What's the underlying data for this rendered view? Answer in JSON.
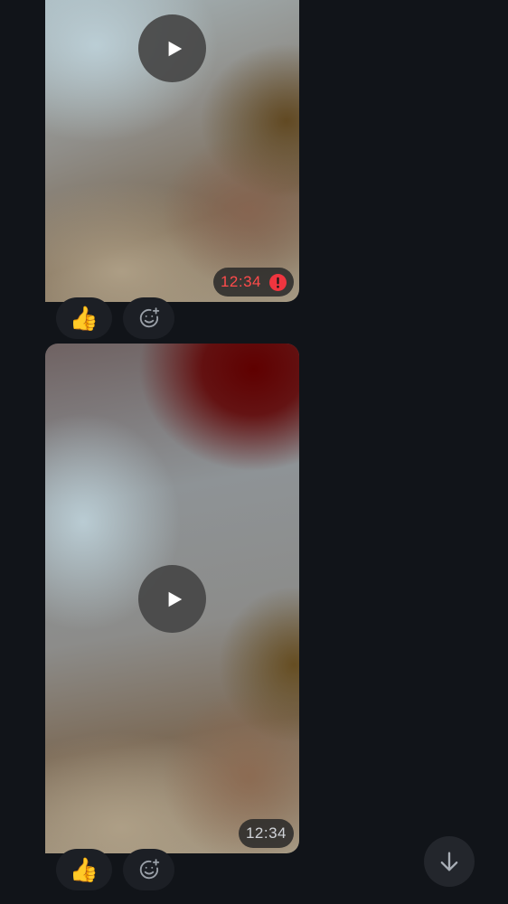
{
  "messages": [
    {
      "type": "video",
      "timestamp": "12:34",
      "status": "error",
      "status_icon": "error-icon",
      "reactions": [
        {
          "emoji": "👍",
          "icon": "thumbs-up"
        }
      ],
      "add_reaction_icon": "add-reaction-icon"
    },
    {
      "type": "video",
      "timestamp": "12:34",
      "status": "sent",
      "reactions": [
        {
          "emoji": "👍",
          "icon": "thumbs-up"
        }
      ],
      "add_reaction_icon": "add-reaction-icon"
    }
  ],
  "scroll_button": {
    "icon": "arrow-down-icon"
  },
  "colors": {
    "background": "#111419",
    "error": "#ff4b4b",
    "badge_bg": "#282828",
    "chip_bg": "#1c1f25"
  }
}
